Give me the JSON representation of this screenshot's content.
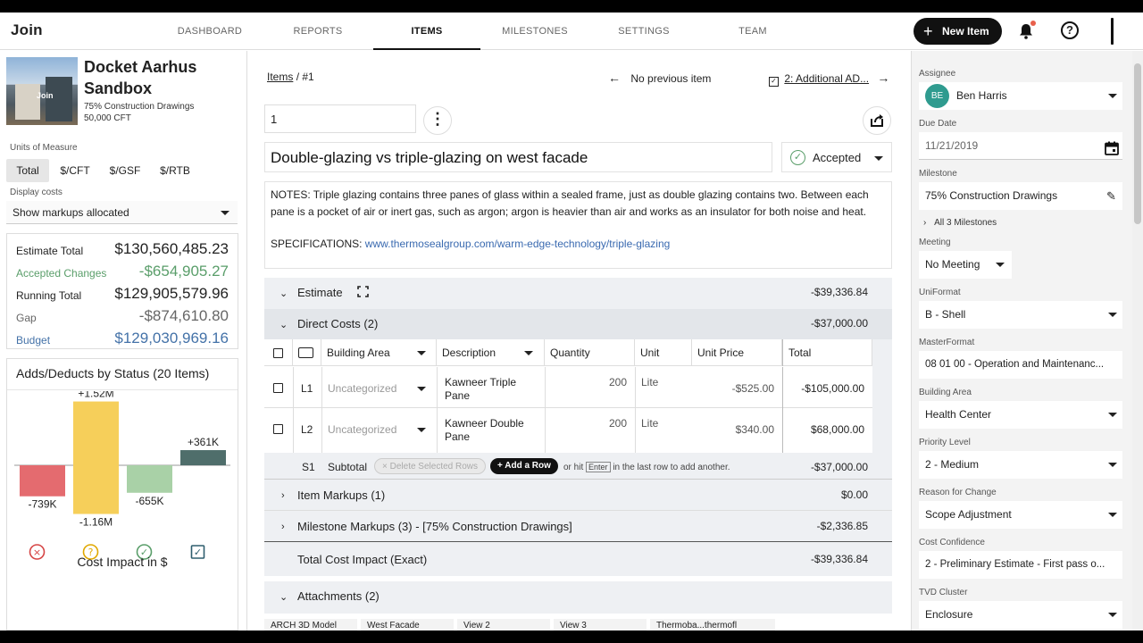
{
  "app": {
    "logo": "Join"
  },
  "nav": {
    "tabs": [
      "DASHBOARD",
      "REPORTS",
      "ITEMS",
      "MILESTONES",
      "SETTINGS",
      "TEAM"
    ],
    "active": "ITEMS",
    "new_item": "New Item"
  },
  "project": {
    "thumb_text": "Join",
    "name": "Docket Aarhus Sandbox",
    "milestone": "75% Construction Drawings",
    "area": "50,000 CFT"
  },
  "units": {
    "label": "Units of Measure",
    "options": [
      "Total",
      "$/CFT",
      "$/GSF",
      "$/RTB"
    ],
    "active": "Total"
  },
  "display_costs": {
    "label": "Display costs",
    "value": "Show markups allocated"
  },
  "totals": [
    {
      "label": "Estimate Total",
      "value": "$130,560,485.23"
    },
    {
      "label": "Accepted Changes",
      "value": "-$654,905.27"
    },
    {
      "label": "Running Total",
      "value": "$129,905,579.96"
    },
    {
      "label": "Gap",
      "value": "-$874,610.80"
    },
    {
      "label": "Budget",
      "value": "$129,030,969.16"
    }
  ],
  "adds_deducts": {
    "title": "Adds/Deducts by Status (20 Items)",
    "footer": "Cost Impact in $"
  },
  "chart_data": {
    "type": "bar",
    "categories": [
      "rejected",
      "pending",
      "accepted",
      "incorporated"
    ],
    "series": [
      {
        "values": [
          -739,
          1520,
          -655,
          361
        ]
      },
      {
        "values": [
          0,
          -1160,
          0,
          0
        ]
      }
    ],
    "labels": {
      "rejected": [
        "-739K"
      ],
      "pending": [
        "+1.52M",
        "-1.16M"
      ],
      "accepted": [
        "-655K"
      ],
      "incorporated": [
        "+361K"
      ]
    },
    "colors": {
      "rejected": "#e46b6f",
      "pending": "#f6cf5a",
      "accepted": "#a9d1a7",
      "incorporated": "#4f6e6b"
    }
  },
  "item": {
    "breadcrumb_root": "Items",
    "breadcrumb_current": "#1",
    "prev": "No previous item",
    "next": "2: Additional AD...",
    "number": "1",
    "title": "Double-glazing vs triple-glazing on west facade",
    "status": "Accepted",
    "notes": "NOTES:  Triple glazing contains three panes of glass within a sealed frame, just as double glazing contains two. Between each pane is a pocket of air or inert gas, such as argon; argon is heavier than air and works as an insulator for both noise and heat.",
    "spec_label": "SPECIFICATIONS: ",
    "spec_link": "www.thermosealgroup.com/warm-edge-technology/triple-glazing"
  },
  "estimate": {
    "label": "Estimate",
    "amount": "-$39,336.84",
    "direct_label": "Direct Costs (2)",
    "direct_amount": "-$37,000.00",
    "columns": [
      "Building Area",
      "Description",
      "Quantity",
      "Unit",
      "Unit Price",
      "Total"
    ],
    "rows": [
      {
        "id": "L1",
        "area": "Uncategorized",
        "desc": "Kawneer Triple Pane",
        "qty": "200",
        "unit": "Lite",
        "price": "-$525.00",
        "total": "-$105,000.00"
      },
      {
        "id": "L2",
        "area": "Uncategorized",
        "desc": "Kawneer Double Pane",
        "qty": "200",
        "unit": "Lite",
        "price": "$340.00",
        "total": "$68,000.00"
      }
    ],
    "subtotal_id": "S1",
    "subtotal_label": "Subtotal",
    "delete_rows": "Delete Selected Rows",
    "add_row": "Add a Row",
    "hint_pre": "or hit",
    "hint_key": "Enter",
    "hint_post": "in the last row to add another.",
    "subtotal": "-$37,000.00",
    "item_markups": "Item Markups (1)",
    "item_markups_amount": "$0.00",
    "milestone_markups": "Milestone Markups (3) - [75% Construction Drawings]",
    "milestone_markups_amount": "-$2,336.85",
    "total_label": "Total Cost Impact (Exact)",
    "total_amount": "-$39,336.84"
  },
  "attachments": {
    "label": "Attachments (2)",
    "files": [
      "ARCH 3D Model",
      "West Facade",
      "View 2",
      "View 3",
      "Thermoba...thermofl"
    ]
  },
  "sidebar": {
    "assignee_label": "Assignee",
    "assignee_initials": "BE",
    "assignee": "Ben Harris",
    "due_label": "Due Date",
    "due": "11/21/2019",
    "milestone_label": "Milestone",
    "milestone": "75% Construction Drawings",
    "all_milestones": "All 3 Milestones",
    "meeting_label": "Meeting",
    "meeting": "No Meeting",
    "uniformat_label": "UniFormat",
    "uniformat": "B - Shell",
    "masterformat_label": "MasterFormat",
    "masterformat": "08 01 00 - Operation and Maintenanc...",
    "building_label": "Building Area",
    "building": "Health Center",
    "priority_label": "Priority Level",
    "priority": "2 - Medium",
    "reason_label": "Reason for Change",
    "reason": "Scope Adjustment",
    "confidence_label": "Cost Confidence",
    "confidence": "2 - Preliminary Estimate - First pass o...",
    "tvd_label": "TVD Cluster",
    "tvd": "Enclosure"
  }
}
